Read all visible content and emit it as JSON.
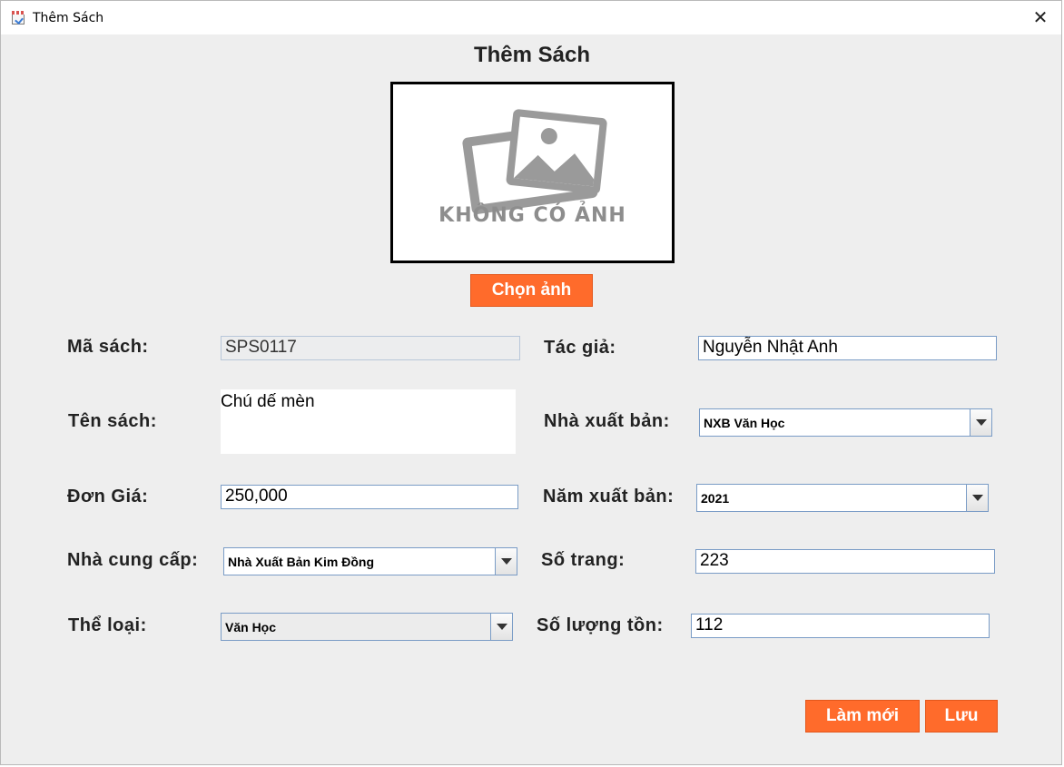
{
  "window": {
    "title": "Thêm Sách",
    "close_glyph": "✕",
    "icon": "book-checklist-icon"
  },
  "heading": "Thêm Sách",
  "image": {
    "placeholder_text": "KHÔNG CÓ ẢNH",
    "icon": "image-placeholder-icon",
    "choose_button": "Chọn ảnh"
  },
  "form": {
    "book_id": {
      "label": "Mã sách:",
      "value": "SPS0117"
    },
    "title": {
      "label": "Tên sách:",
      "value": "Chú dế mèn"
    },
    "price": {
      "label": "Đơn Giá:",
      "value": "250,000"
    },
    "supplier": {
      "label": "Nhà cung cấp:",
      "value": "Nhà Xuất Bản Kim Đồng"
    },
    "category": {
      "label": "Thể loại:",
      "value": "Văn Học"
    },
    "author": {
      "label": "Tác giả:",
      "value": "Nguyễn Nhật Anh"
    },
    "publisher": {
      "label": "Nhà xuất bản:",
      "value": "NXB Văn Học"
    },
    "year": {
      "label": "Năm xuất bản:",
      "value": "2021"
    },
    "pages": {
      "label": "Số trang:",
      "value": "223"
    },
    "stock": {
      "label": "Số lượng tồn:",
      "value": "112"
    }
  },
  "buttons": {
    "reset": "Làm mới",
    "save": "Lưu"
  },
  "colors": {
    "accent": "#ff6b2b",
    "background": "#eeeeee",
    "field_border": "#7a9cc6"
  }
}
